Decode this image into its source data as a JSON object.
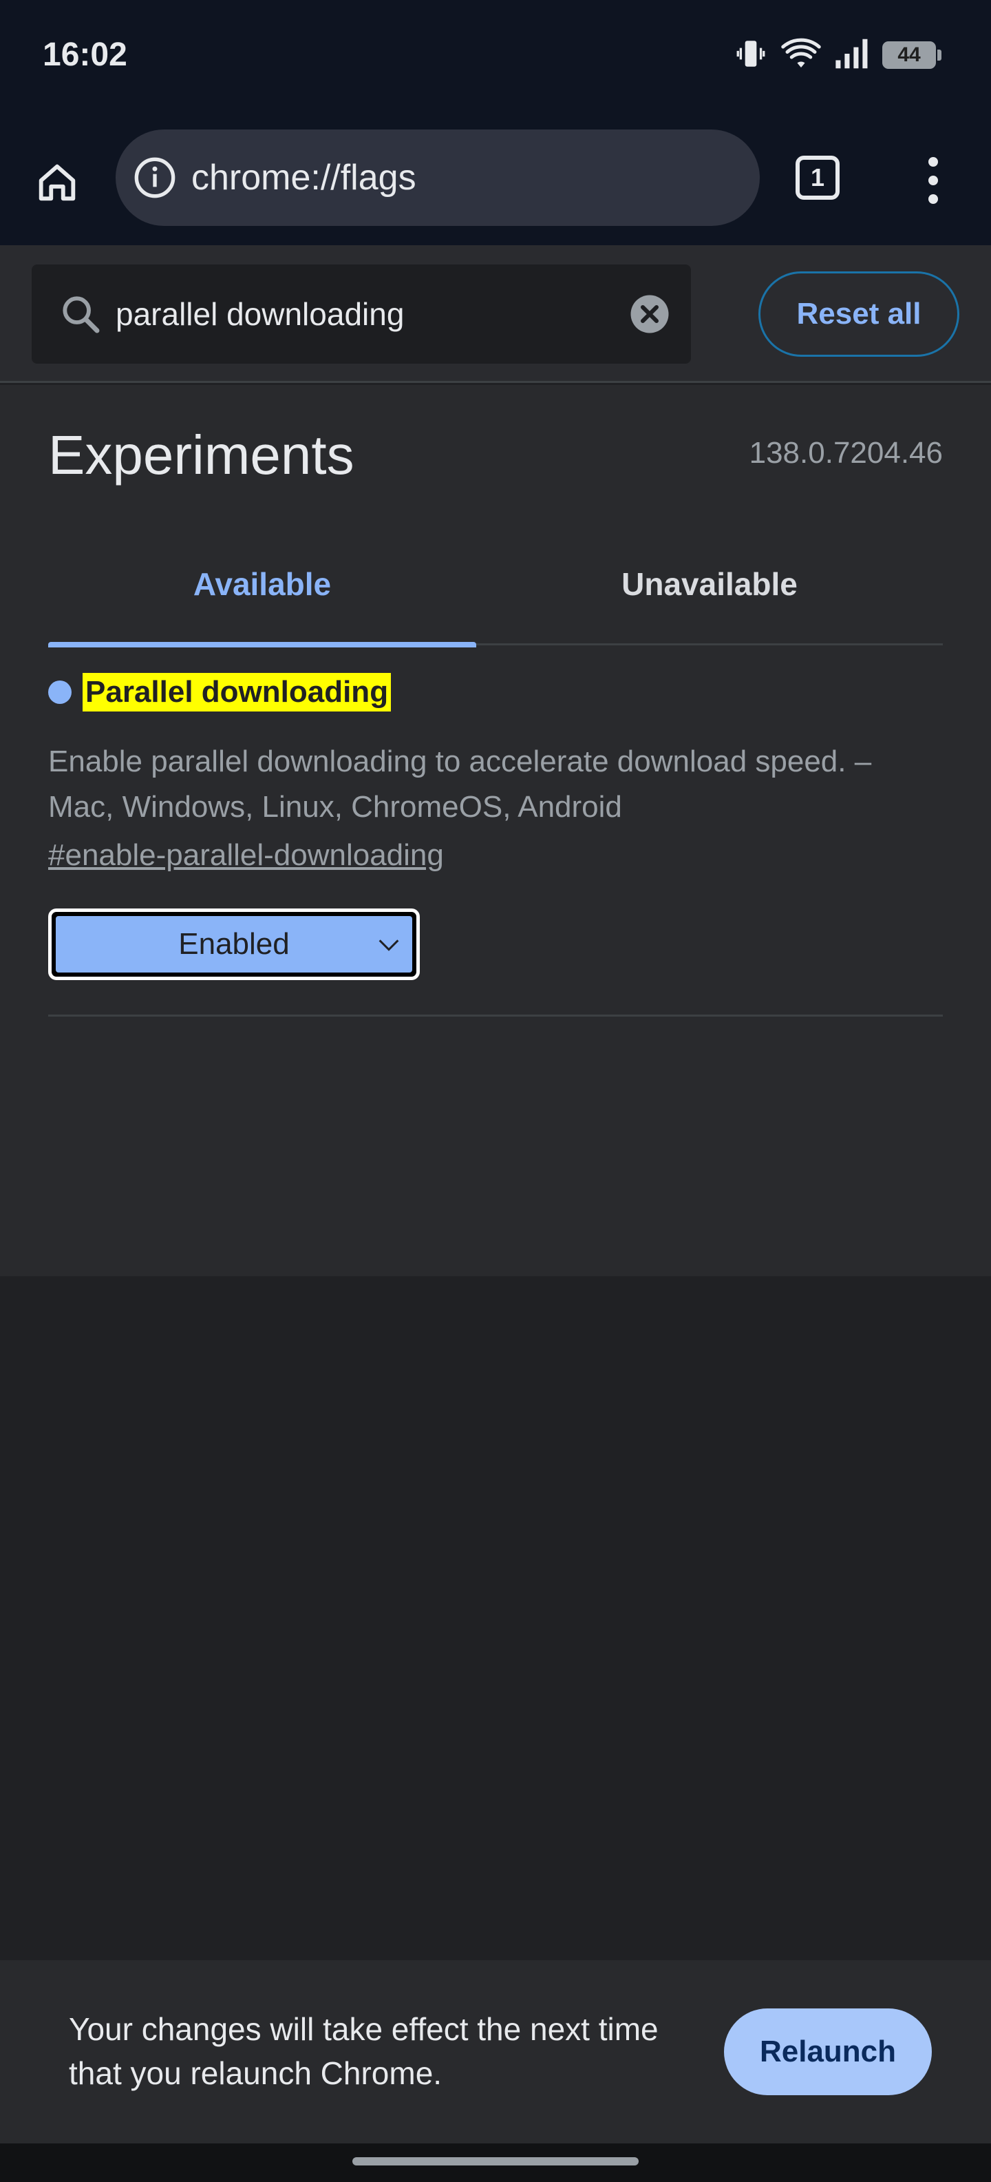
{
  "status_bar": {
    "time": "16:02",
    "battery_level": "44",
    "icons": [
      "vibrate-icon",
      "wifi-icon",
      "signal-icon",
      "battery-icon"
    ]
  },
  "toolbar": {
    "url": "chrome://flags",
    "tab_count": "1",
    "icons": [
      "home-icon",
      "info-icon",
      "tab-switcher-icon",
      "more-menu-icon"
    ]
  },
  "search": {
    "value": "parallel downloading",
    "reset_label": "Reset all",
    "icons": [
      "search-icon",
      "clear-icon"
    ]
  },
  "main": {
    "title": "Experiments",
    "version": "138.0.7204.46",
    "tabs": [
      {
        "label": "Available",
        "selected": true
      },
      {
        "label": "Unavailable",
        "selected": false
      }
    ]
  },
  "flag": {
    "name": "Parallel downloading",
    "description": "Enable parallel downloading to accelerate download speed. – Mac, Windows, Linux, ChromeOS, Android",
    "link": "#enable-parallel-downloading",
    "selected_option": "Enabled"
  },
  "relaunch": {
    "message": "Your changes will take effect the next time that you relaunch Chrome.",
    "button_label": "Relaunch"
  },
  "colors": {
    "accent": "#8ab4f8",
    "highlight": "#ffff00",
    "background": "#202124",
    "panel": "#292a2d"
  }
}
